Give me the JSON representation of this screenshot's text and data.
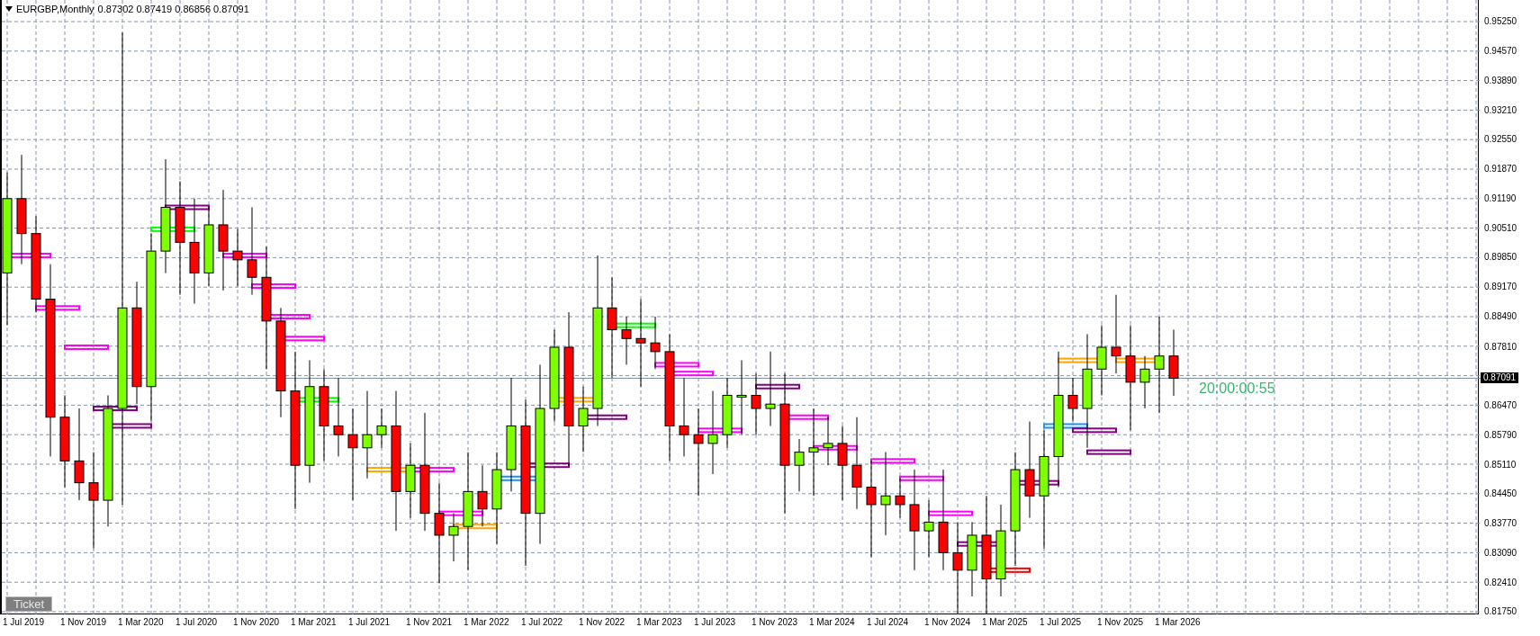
{
  "chart": {
    "symbol": "EURGBP,Monthly",
    "ohlc": [
      "0.87302",
      "0.87419",
      "0.86856",
      "0.87091"
    ],
    "timer": "20:00:00:55",
    "current_price": "0.87091",
    "price_axis": [
      "0.95250",
      "0.94570",
      "0.93890",
      "0.93210",
      "0.92550",
      "0.91870",
      "0.91190",
      "0.90510",
      "0.89850",
      "0.89170",
      "0.88490",
      "0.87810",
      "0.86470",
      "0.85790",
      "0.85110",
      "0.84450",
      "0.83770",
      "0.83090",
      "0.82410",
      "0.81750"
    ],
    "time_axis": [
      "1 Jul 2019",
      "1 Nov 2019",
      "1 Mar 2020",
      "1 Jul 2020",
      "1 Nov 2020",
      "1 Mar 2021",
      "1 Jul 2021",
      "1 Nov 2021",
      "1 Mar 2022",
      "1 Jul 2022",
      "1 Nov 2022",
      "1 Mar 2023",
      "1 Jul 2023",
      "1 Nov 2023",
      "1 Mar 2024",
      "1 Jul 2024",
      "1 Nov 2024",
      "1 Mar 2025",
      "1 Jul 2025",
      "1 Nov 2025",
      "1 Mar 2026"
    ]
  },
  "ticket_button": "Ticket"
}
